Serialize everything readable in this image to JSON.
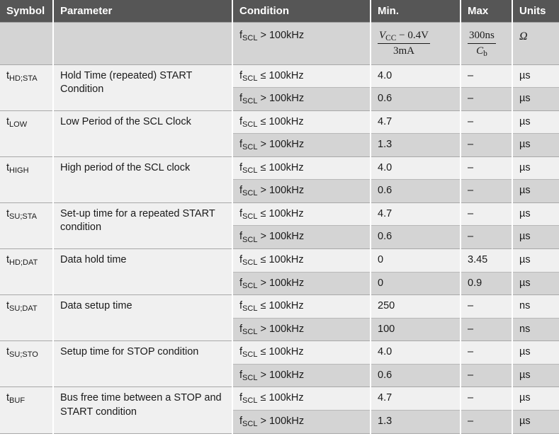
{
  "table": {
    "columns": [
      {
        "key": "symbol",
        "label": "Symbol"
      },
      {
        "key": "parameter",
        "label": "Parameter"
      },
      {
        "key": "condition",
        "label": "Condition"
      },
      {
        "key": "min",
        "label": "Min."
      },
      {
        "key": "max",
        "label": "Max"
      },
      {
        "key": "units",
        "label": "Units"
      }
    ],
    "colors": {
      "header_bg": "#565656",
      "header_text": "#ffffff",
      "row_light": "#f0f0f0",
      "row_dark": "#d4d4d4",
      "border": "#b8b8b8",
      "text": "#1a1a1a"
    },
    "rows": [
      {
        "symbol": "",
        "symbol_sub": "",
        "parameter": "",
        "sub_rows": [
          {
            "condition_base": "f",
            "condition_sub": "SCL",
            "condition_rest": " > 100kHz",
            "min_type": "fraction",
            "min_num": "V",
            "min_num_sub": "CC",
            "min_num_rest": " − 0.4V",
            "min_den": "3mA",
            "max_type": "fraction",
            "max_num": "300ns",
            "max_den": "C",
            "max_den_sub": "b",
            "units": "Ω",
            "units_style": "omega"
          }
        ]
      },
      {
        "symbol": "t",
        "symbol_sub": "HD;STA",
        "parameter": "Hold Time (repeated) START Condition",
        "sub_rows": [
          {
            "condition_base": "f",
            "condition_sub": "SCL",
            "condition_rest": " ≤ 100kHz",
            "min": "4.0",
            "max": "–",
            "units": "µs"
          },
          {
            "condition_base": "f",
            "condition_sub": "SCL",
            "condition_rest": " > 100kHz",
            "min": "0.6",
            "max": "–",
            "units": "µs"
          }
        ]
      },
      {
        "symbol": "t",
        "symbol_sub": "LOW",
        "parameter": "Low Period of the SCL Clock",
        "sub_rows": [
          {
            "condition_base": "f",
            "condition_sub": "SCL",
            "condition_rest": " ≤ 100kHz",
            "min": "4.7",
            "max": "–",
            "units": "µs"
          },
          {
            "condition_base": "f",
            "condition_sub": "SCL",
            "condition_rest": " > 100kHz",
            "min": "1.3",
            "max": "–",
            "units": "µs"
          }
        ]
      },
      {
        "symbol": "t",
        "symbol_sub": "HIGH",
        "parameter": "High period of the SCL clock",
        "sub_rows": [
          {
            "condition_base": "f",
            "condition_sub": "SCL",
            "condition_rest": " ≤ 100kHz",
            "min": "4.0",
            "max": "–",
            "units": "µs"
          },
          {
            "condition_base": "f",
            "condition_sub": "SCL",
            "condition_rest": " > 100kHz",
            "min": "0.6",
            "max": "–",
            "units": "µs"
          }
        ]
      },
      {
        "symbol": "t",
        "symbol_sub": "SU;STA",
        "parameter": "Set-up time for a repeated START condition",
        "sub_rows": [
          {
            "condition_base": "f",
            "condition_sub": "SCL",
            "condition_rest": " ≤ 100kHz",
            "min": "4.7",
            "max": "–",
            "units": "µs"
          },
          {
            "condition_base": "f",
            "condition_sub": "SCL",
            "condition_rest": " > 100kHz",
            "min": "0.6",
            "max": "–",
            "units": "µs"
          }
        ]
      },
      {
        "symbol": "t",
        "symbol_sub": "HD;DAT",
        "parameter": "Data hold time",
        "sub_rows": [
          {
            "condition_base": "f",
            "condition_sub": "SCL",
            "condition_rest": " ≤ 100kHz",
            "min": "0",
            "max": "3.45",
            "units": "µs"
          },
          {
            "condition_base": "f",
            "condition_sub": "SCL",
            "condition_rest": " > 100kHz",
            "min": "0",
            "max": "0.9",
            "units": "µs"
          }
        ]
      },
      {
        "symbol": "t",
        "symbol_sub": "SU;DAT",
        "parameter": "Data setup time",
        "sub_rows": [
          {
            "condition_base": "f",
            "condition_sub": "SCL",
            "condition_rest": " ≤ 100kHz",
            "min": "250",
            "max": "–",
            "units": "ns"
          },
          {
            "condition_base": "f",
            "condition_sub": "SCL",
            "condition_rest": " > 100kHz",
            "min": "100",
            "max": "–",
            "units": "ns"
          }
        ]
      },
      {
        "symbol": "t",
        "symbol_sub": "SU;STO",
        "parameter": "Setup time for STOP condition",
        "sub_rows": [
          {
            "condition_base": "f",
            "condition_sub": "SCL",
            "condition_rest": " ≤ 100kHz",
            "min": "4.0",
            "max": "–",
            "units": "µs"
          },
          {
            "condition_base": "f",
            "condition_sub": "SCL",
            "condition_rest": " > 100kHz",
            "min": "0.6",
            "max": "–",
            "units": "µs"
          }
        ]
      },
      {
        "symbol": "t",
        "symbol_sub": "BUF",
        "parameter": "Bus free time between a STOP and START condition",
        "sub_rows": [
          {
            "condition_base": "f",
            "condition_sub": "SCL",
            "condition_rest": " ≤ 100kHz",
            "min": "4.7",
            "max": "–",
            "units": "µs"
          },
          {
            "condition_base": "f",
            "condition_sub": "SCL",
            "condition_rest": " > 100kHz",
            "min": "1.3",
            "max": "–",
            "units": "µs"
          }
        ]
      }
    ]
  }
}
